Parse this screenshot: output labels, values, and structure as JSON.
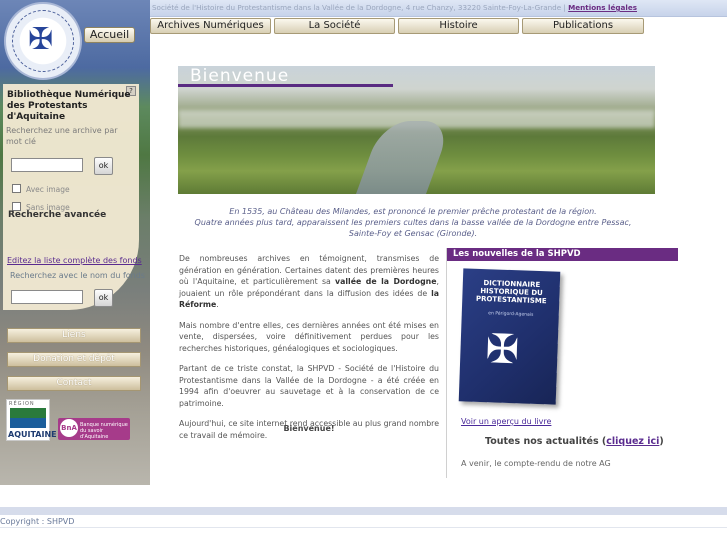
{
  "topbar": {
    "address": "Société de l'Histoire du Protestantisme dans la Vallée de la Dordogne, 4 rue Chanzy, 33220 Sainte-Foy-La-Grande |",
    "legal_link": "Mentions légales"
  },
  "nav": {
    "items": [
      "Archives Numériques",
      "La Société",
      "Histoire",
      "Publications"
    ]
  },
  "sidebar": {
    "home_button": "Accueil",
    "help_icon": "?",
    "library_title": "Bibliothèque Numérique des Protestants d'Aquitaine",
    "search_label": "Recherchez une archive par mot clé",
    "search_value": "",
    "ok_label": "ok",
    "with_image": "Avec image",
    "without_image": "Sans image",
    "advanced_search": "Recherche avancée",
    "full_list_link": "Editez la liste complète des fonds",
    "fund_label": "Recherchez avec le nom du fonds",
    "fund_value": "",
    "buttons": [
      "Liens",
      "Donation et dépôt",
      "Contact"
    ],
    "partner_region": "RÉGION",
    "partner_aquitaine": "AQUITAINE",
    "partner_bna_initials": "BnA",
    "partner_bna_text": "Banque numérique du savoir d'Aquitaine"
  },
  "banner": {
    "title": "Bienvenue"
  },
  "caption": {
    "line1": "En 1535, au Château des Milandes, est prononcé le premier prêche protestant de la région.",
    "line2": "Quatre années plus tard, apparaissent les premiers cultes dans la basse vallée de la Dordogne entre Pessac, Sainte-Foy et Gensac (Gironde)."
  },
  "intro": {
    "p1_a": "De nombreuses archives en témoignent, transmises de génération en génération. Certaines datent des premières heures où l'Aquitaine, et particulièrement sa ",
    "p1_b": "vallée de la Dordogne",
    "p1_c": ", jouaient un rôle prépondérant dans la diffusion des idées de ",
    "p1_d": "la Réforme",
    "p1_e": ".",
    "p2": "Mais nombre d'entre elles, ces dernières années ont été mises en vente, dispersées, voire définitivement perdues pour les recherches historiques, généalogiques et sociologiques.",
    "p3": "Partant de ce triste constat, la SHPVD - Société de l'Histoire du Protestantisme dans la Vallée de la Dordogne - a été créée en 1994 afin d'oeuvrer au sauvetage et à la conservation de ce patrimoine.",
    "p4": "Aujourd'hui, ce site internet rend accessible au plus grand nombre ce travail de mémoire.",
    "welcome": "Bienvenue!"
  },
  "news": {
    "header": "Les nouvelles de la SHPVD",
    "book_title": "DICTIONNAIRE HISTORIQUE DU PROTESTANTISME",
    "book_subtitle": "en Périgord-Agenais",
    "book_link": "Voir un aperçu du livre",
    "actus_prefix": "Toutes nos actualités (",
    "actus_link": "cliquez ici",
    "actus_suffix": ")",
    "ag_note": "A venir, le compte-rendu de notre AG"
  },
  "footer": {
    "copyright": "Copyright : SHPVD"
  }
}
